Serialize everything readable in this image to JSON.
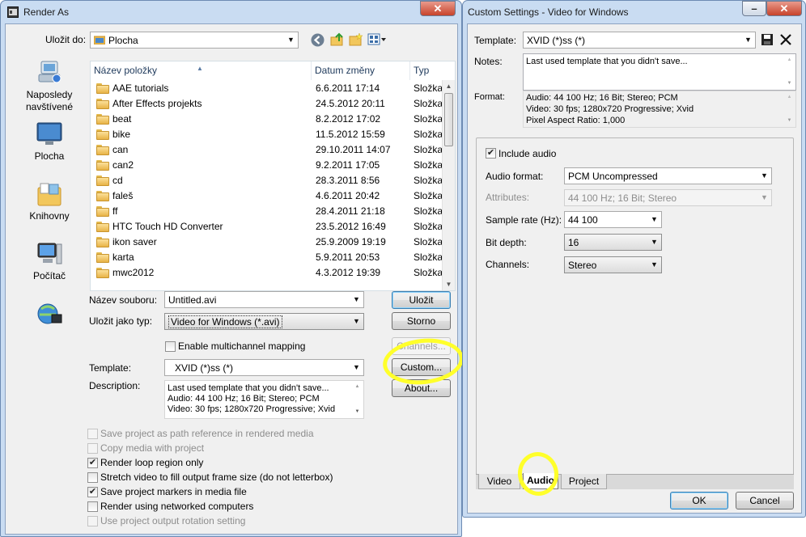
{
  "render_as": {
    "title": "Render As",
    "close_glyph": "✕",
    "save_in_label": "Uložit do:",
    "save_in_value": "Plocha",
    "toolbar_icons": [
      "back-icon",
      "up-folder-icon",
      "new-folder-icon",
      "view-menu-icon"
    ],
    "places": [
      {
        "label": "Naposledy navštívené",
        "icon": "recent-places-icon"
      },
      {
        "label": "Plocha",
        "icon": "desktop-icon"
      },
      {
        "label": "Knihovny",
        "icon": "libraries-icon"
      },
      {
        "label": "Počítač",
        "icon": "computer-icon"
      },
      {
        "label": "",
        "icon": "network-icon"
      }
    ],
    "columns": {
      "name": "Název položky",
      "date": "Datum změny",
      "type": "Typ"
    },
    "files": [
      {
        "name": "AAE tutorials",
        "date": "6.6.2011 17:14",
        "type": "Složka"
      },
      {
        "name": "After Effects projekts",
        "date": "24.5.2012 20:11",
        "type": "Složka"
      },
      {
        "name": "beat",
        "date": "8.2.2012 17:02",
        "type": "Složka"
      },
      {
        "name": "bike",
        "date": "11.5.2012 15:59",
        "type": "Složka"
      },
      {
        "name": "can",
        "date": "29.10.2011 14:07",
        "type": "Složka"
      },
      {
        "name": "can2",
        "date": "9.2.2011 17:05",
        "type": "Složka"
      },
      {
        "name": "cd",
        "date": "28.3.2011 8:56",
        "type": "Složka"
      },
      {
        "name": "faleš",
        "date": "4.6.2011 20:42",
        "type": "Složka"
      },
      {
        "name": "ff",
        "date": "28.4.2011 21:18",
        "type": "Složka"
      },
      {
        "name": "HTC Touch HD Converter",
        "date": "23.5.2012 16:49",
        "type": "Složka"
      },
      {
        "name": "ikon saver",
        "date": "25.9.2009 19:19",
        "type": "Složka"
      },
      {
        "name": "karta",
        "date": "5.9.2011 20:53",
        "type": "Složka"
      },
      {
        "name": "mwc2012",
        "date": "4.3.2012 19:39",
        "type": "Složka"
      }
    ],
    "filename_label": "Název souboru:",
    "filename_value": "Untitled.avi",
    "filetype_label": "Uložit jako typ:",
    "filetype_value": "Video for Windows (*.avi)",
    "multichannel_label": "Enable multichannel mapping",
    "template_label": "Template:",
    "template_value": "XVID (*)ss (*)",
    "description_label": "Description:",
    "description_lines": [
      "Last used template that you didn't save...",
      "Audio: 44 100 Hz; 16 Bit; Stereo; PCM",
      "Video: 30 fps; 1280x720 Progressive; Xvid"
    ],
    "buttons": {
      "save": "Uložit",
      "cancel": "Storno",
      "channels": "Channels...",
      "custom": "Custom...",
      "about": "About..."
    },
    "options": [
      {
        "label": "Save project as path reference in rendered media",
        "checked": false,
        "enabled": false
      },
      {
        "label": "Copy media with project",
        "checked": false,
        "enabled": false
      },
      {
        "label": "Render loop region only",
        "checked": true,
        "enabled": true
      },
      {
        "label": "Stretch video to fill output frame size (do not letterbox)",
        "checked": false,
        "enabled": true
      },
      {
        "label": "Save project markers in media file",
        "checked": true,
        "enabled": true
      },
      {
        "label": "Render using networked computers",
        "checked": false,
        "enabled": true
      },
      {
        "label": "Use project output rotation setting",
        "checked": false,
        "enabled": false
      }
    ]
  },
  "custom_settings": {
    "title": "Custom Settings - Video for Windows",
    "minimize_glyph": "–",
    "close_glyph": "✕",
    "template_label": "Template:",
    "template_value": "XVID (*)ss (*)",
    "template_icons": [
      "save-template-icon",
      "delete-template-icon"
    ],
    "notes_label": "Notes:",
    "notes_value": "Last used template that you didn't save...",
    "format_label": "Format:",
    "format_lines": [
      "Audio: 44 100 Hz; 16 Bit; Stereo; PCM",
      "Video: 30 fps; 1280x720 Progressive; Xvid",
      "Pixel Aspect Ratio: 1,000"
    ],
    "include_audio_label": "Include audio",
    "include_audio_checked": true,
    "audio_format_label": "Audio format:",
    "audio_format_value": "PCM Uncompressed",
    "attributes_label": "Attributes:",
    "attributes_value": "44 100 Hz; 16 Bit; Stereo",
    "sample_rate_label": "Sample rate (Hz):",
    "sample_rate_value": "44 100",
    "bit_depth_label": "Bit depth:",
    "bit_depth_value": "16",
    "channels_label": "Channels:",
    "channels_value": "Stereo",
    "tabs": [
      "Video",
      "Audio",
      "Project"
    ],
    "active_tab": "Audio",
    "ok_label": "OK",
    "cancel_label": "Cancel"
  }
}
